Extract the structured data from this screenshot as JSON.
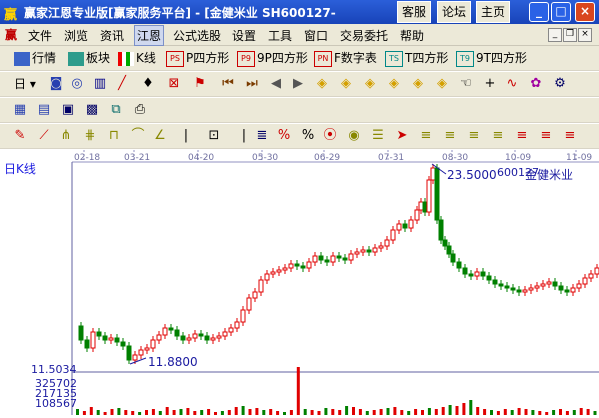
{
  "window": {
    "title": "赢家江恩专业版[赢家服务平台] - [金健米业  SH600127-",
    "buttons": {
      "kefu": "客服",
      "luntan": "论坛",
      "zhuye": "主页"
    },
    "min": "_",
    "max": "□",
    "close": "×"
  },
  "menu": {
    "items": [
      "文件",
      "浏览",
      "资讯",
      "江恩",
      "公式选股",
      "设置",
      "工具",
      "窗口",
      "交易委托",
      "帮助"
    ]
  },
  "toolbar1": {
    "items": [
      "行情",
      "板块",
      "K线",
      "P四方形",
      "9P四方形",
      "F数字表",
      "T四方形",
      "9T四方形"
    ]
  },
  "toolbar2": {
    "period": "日"
  },
  "chart": {
    "period_label": "日K线",
    "dates": [
      "02-18",
      "03-21",
      "04-20",
      "05-30",
      "06-29",
      "07-31",
      "08-30",
      "10-09",
      "11-09"
    ],
    "high": "23.5000",
    "low": "11.8800",
    "code": "600127",
    "name": "金健米业",
    "y_min_label": "11.5034",
    "vol_labels": [
      "325702",
      "217135",
      "108567"
    ]
  },
  "chart_data": {
    "type": "candlestick",
    "x_labels": [
      "02-18",
      "03-21",
      "04-20",
      "05-30",
      "06-29",
      "07-31",
      "08-30",
      "10-09",
      "11-09"
    ],
    "annotations": [
      {
        "label": "23.5000"
      },
      {
        "label": "11.8800"
      }
    ],
    "y_axis_label": "11.5034",
    "volume_ticks": [
      325702,
      217135,
      108567
    ]
  },
  "colors": {
    "up": "#e00000",
    "down": "#008000",
    "axis_text": "#1a1aa0",
    "title_bg": "#1f4fd0"
  }
}
